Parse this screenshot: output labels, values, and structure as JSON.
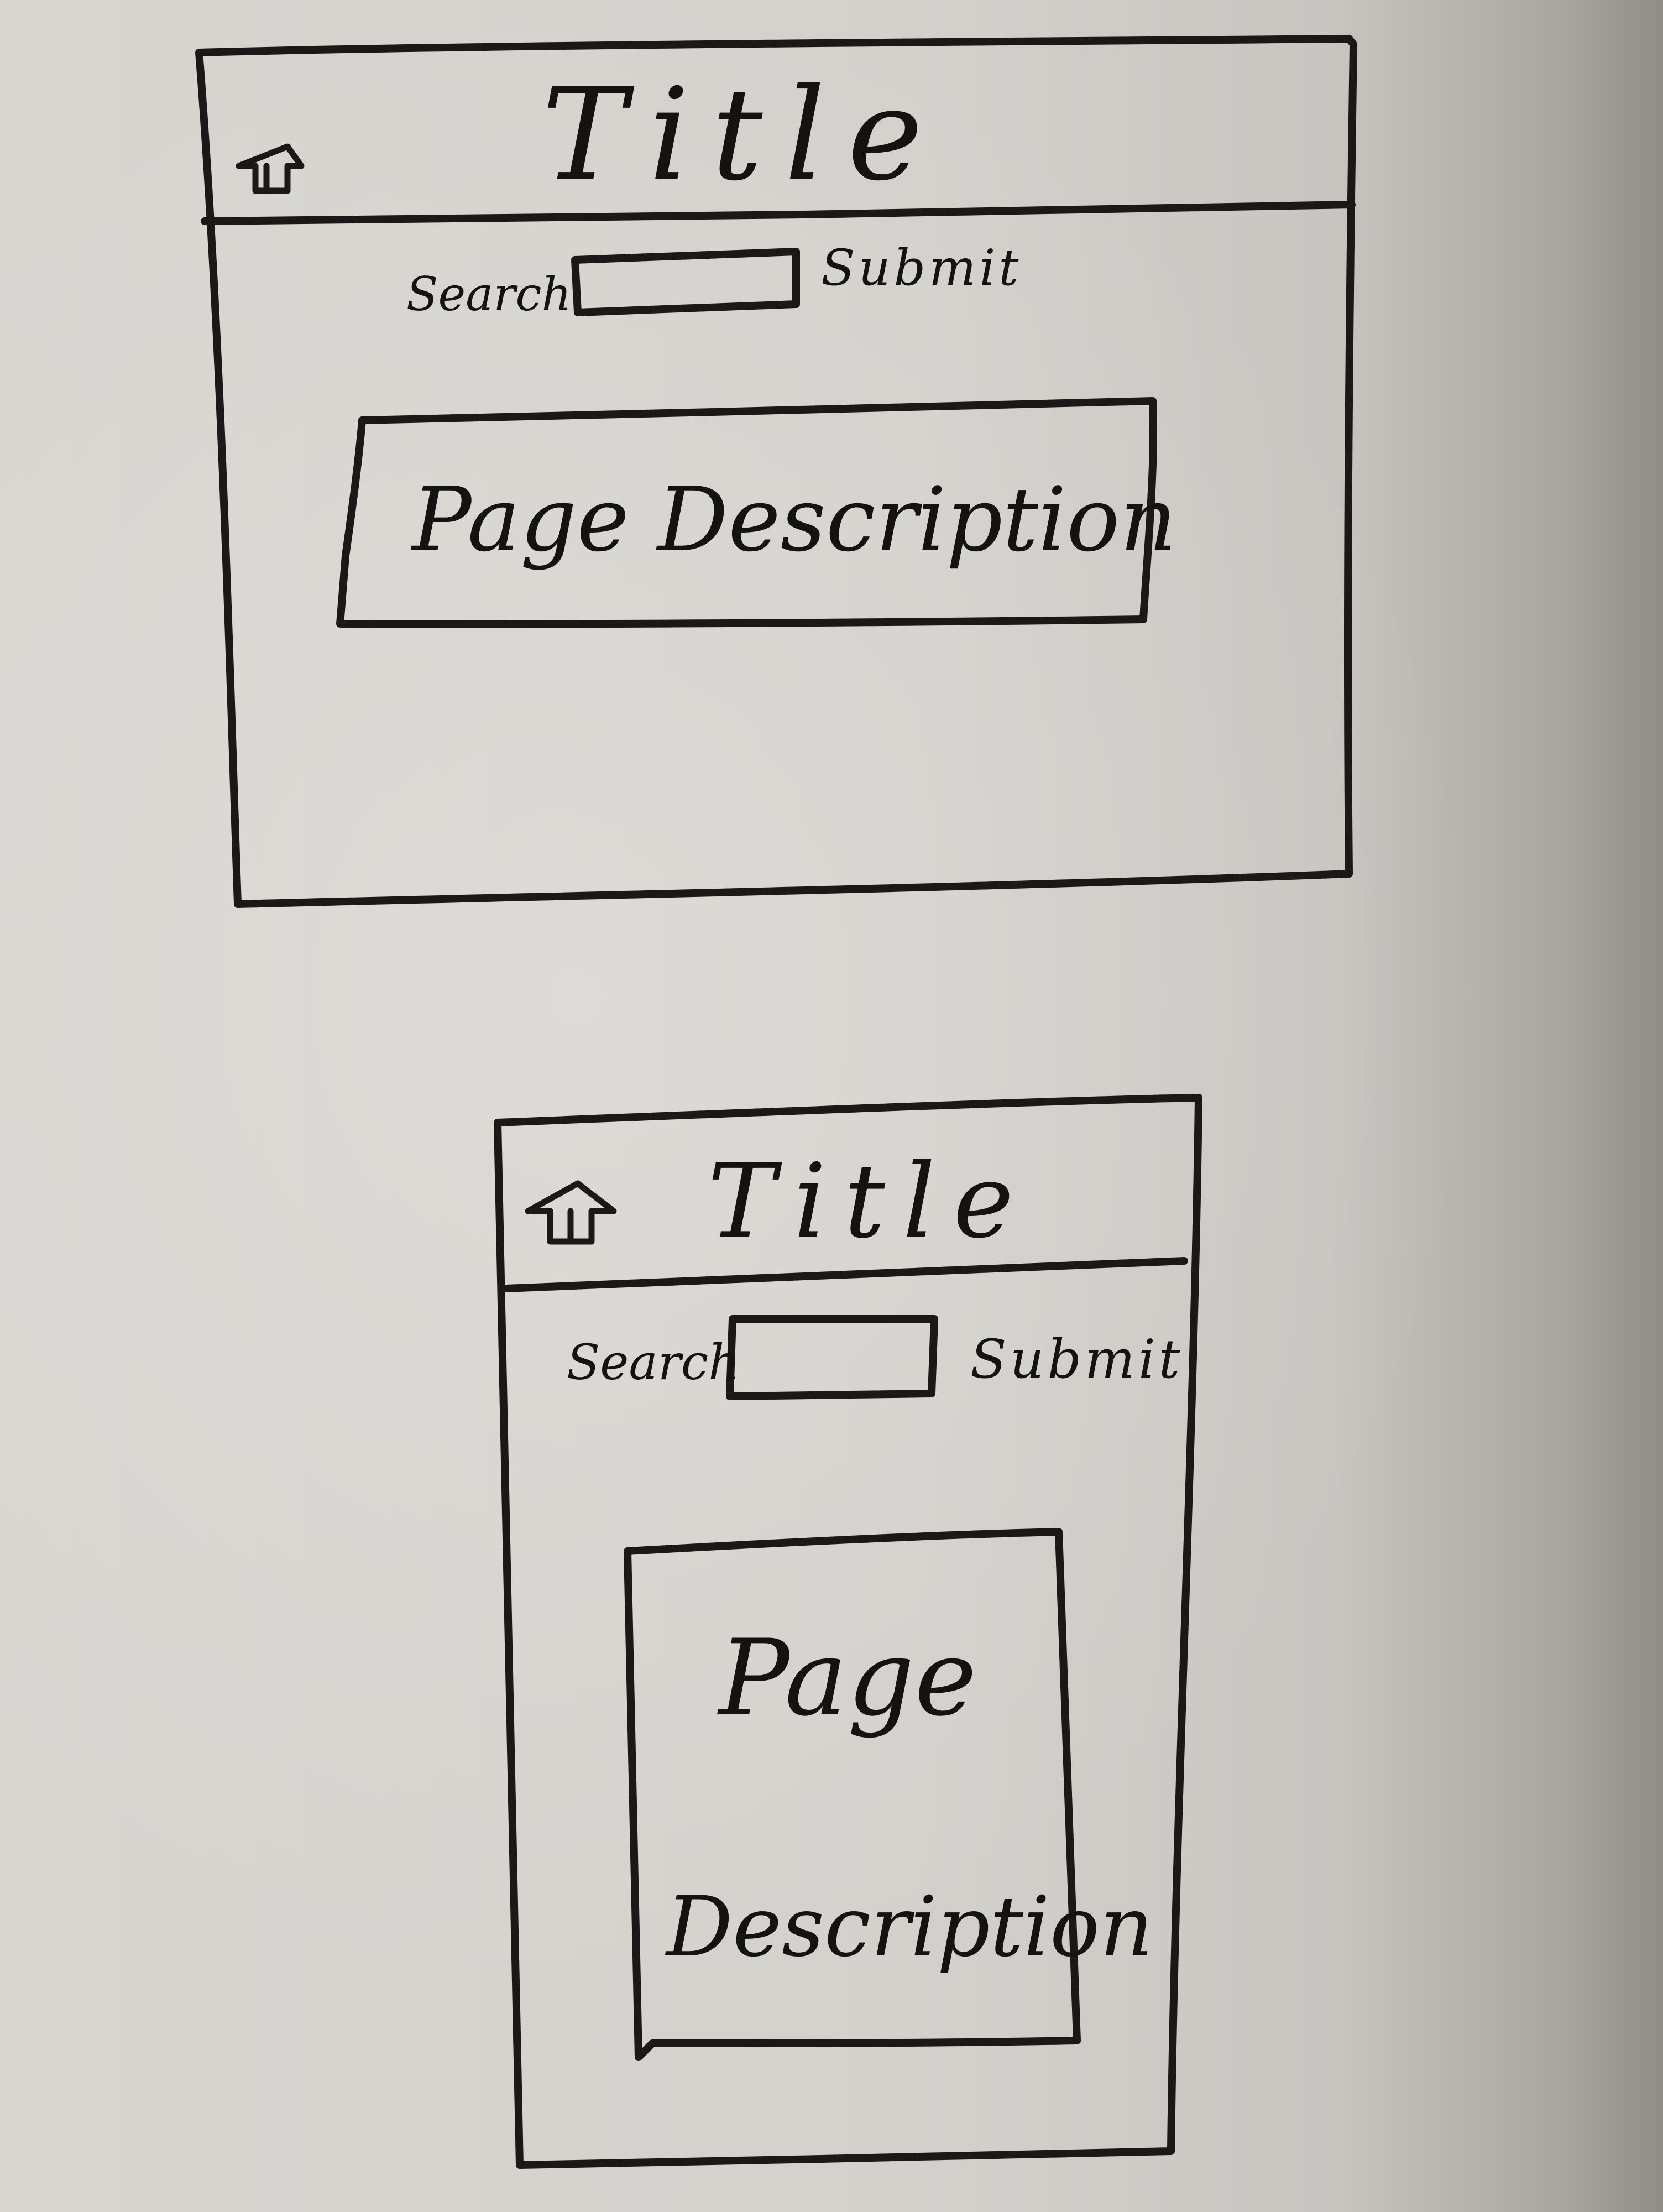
{
  "sketches": [
    {
      "variant": "landscape",
      "header": {
        "title": "Title",
        "icon": "home-icon"
      },
      "search": {
        "label": "Search",
        "value": "",
        "submit_label": "Submit"
      },
      "content": {
        "description": "Page Description"
      }
    },
    {
      "variant": "portrait",
      "header": {
        "title": "Title",
        "icon": "home-icon"
      },
      "search": {
        "label": "Search",
        "value": "",
        "submit_label": "Submit"
      },
      "content": {
        "description_line1": "Page",
        "description_line2": "Description"
      }
    }
  ],
  "colors": {
    "ink": "#1b1918",
    "board": "#d6d4cf"
  }
}
